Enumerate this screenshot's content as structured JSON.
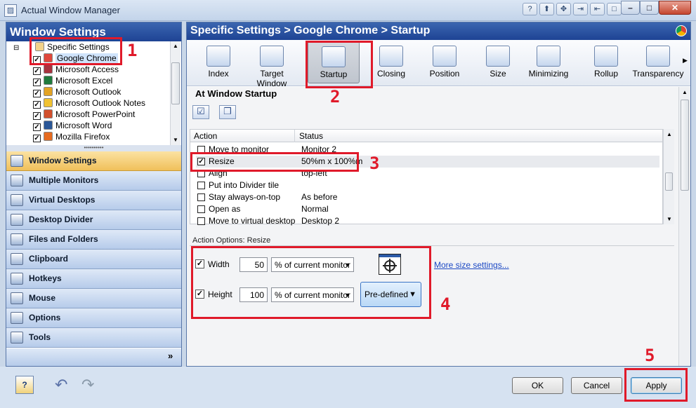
{
  "app": {
    "title": "Actual Window Manager"
  },
  "title_tools": [
    "?",
    "⬆",
    "✥",
    "⇥",
    "⇤",
    "□",
    "⊟"
  ],
  "left": {
    "header": "Window Settings",
    "tree": [
      {
        "label": "Specific Settings",
        "level": 0,
        "checked": null,
        "selected": false
      },
      {
        "label": "Google Chrome",
        "level": 1,
        "checked": true,
        "selected": true,
        "color": "#e0483c"
      },
      {
        "label": "Microsoft Access",
        "level": 1,
        "checked": true,
        "selected": false,
        "color": "#a8323e"
      },
      {
        "label": "Microsoft Excel",
        "level": 1,
        "checked": true,
        "selected": false,
        "color": "#1f7a3d"
      },
      {
        "label": "Microsoft Outlook",
        "level": 1,
        "checked": true,
        "selected": false,
        "color": "#e3a323"
      },
      {
        "label": "Microsoft Outlook Notes",
        "level": 1,
        "checked": true,
        "selected": false,
        "color": "#f1c232"
      },
      {
        "label": "Microsoft PowerPoint",
        "level": 1,
        "checked": true,
        "selected": false,
        "color": "#d2502d"
      },
      {
        "label": "Microsoft Word",
        "level": 1,
        "checked": true,
        "selected": false,
        "color": "#2b5797"
      },
      {
        "label": "Mozilla Firefox",
        "level": 1,
        "checked": true,
        "selected": false,
        "color": "#e66b20"
      }
    ],
    "nav": [
      "Window Settings",
      "Multiple Monitors",
      "Virtual Desktops",
      "Desktop Divider",
      "Files and Folders",
      "Clipboard",
      "Hotkeys",
      "Mouse",
      "Options",
      "Tools"
    ],
    "active_nav": 0,
    "more": "»"
  },
  "right": {
    "header": "Specific Settings > Google Chrome > Startup",
    "tools": [
      "Index",
      "Target Window",
      "Startup",
      "Closing",
      "Position",
      "Size",
      "Minimizing",
      "Rollup",
      "Transparency"
    ],
    "selected_tool": 2,
    "section_title": "At Window Startup",
    "grid_headers": [
      "Action",
      "Status"
    ],
    "rows": [
      {
        "action": "Move to monitor",
        "status": "Monitor 2",
        "checked": false
      },
      {
        "action": "Resize",
        "status": "50%m x 100%m",
        "checked": true
      },
      {
        "action": "Align",
        "status": "top-left",
        "checked": false
      },
      {
        "action": "Put into Divider tile",
        "status": "",
        "checked": false
      },
      {
        "action": "Stay always-on-top",
        "status": "As before",
        "checked": false
      },
      {
        "action": "Open as",
        "status": "Normal",
        "checked": false
      },
      {
        "action": "Move to virtual desktop",
        "status": "Desktop 2",
        "checked": false
      }
    ],
    "options_title": "Action Options: Resize",
    "width": {
      "label": "Width",
      "value": "50",
      "unit": "% of current monitor",
      "checked": true
    },
    "height": {
      "label": "Height",
      "value": "100",
      "unit": "% of current monitor",
      "checked": true
    },
    "more_link": "More size settings...",
    "predefined": "Pre-defined"
  },
  "footer": {
    "ok": "OK",
    "cancel": "Cancel",
    "apply": "Apply"
  },
  "annotations": [
    "1",
    "2",
    "3",
    "4",
    "5"
  ]
}
